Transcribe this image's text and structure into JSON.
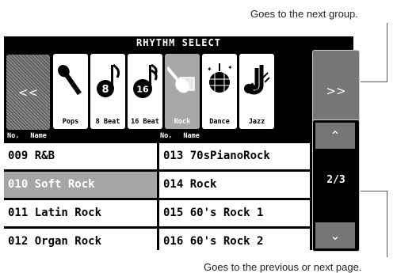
{
  "annotations": {
    "top": "Goes to the next group.",
    "bottom": "Goes to the previous or next page."
  },
  "screen": {
    "title": "RHYTHM SELECT",
    "prev_group_label": "<<",
    "next_group_label": ">>",
    "categories": [
      {
        "label": "Pops",
        "icon": "microphone-icon"
      },
      {
        "label": "8 Beat",
        "icon": "eighth-note-icon"
      },
      {
        "label": "16 Beat",
        "icon": "sixteenth-note-icon"
      },
      {
        "label": "Rock",
        "icon": "electric-guitar-icon",
        "selected": true
      },
      {
        "label": "Dance",
        "icon": "disco-ball-icon"
      },
      {
        "label": "Jazz",
        "icon": "saxophone-icon"
      }
    ],
    "column_headers": {
      "no": "No.",
      "name": "Name"
    },
    "rhythms": [
      {
        "text": "009 R&B"
      },
      {
        "text": "010 Soft Rock",
        "selected": true
      },
      {
        "text": "011 Latin Rock"
      },
      {
        "text": "012 Organ Rock"
      },
      {
        "text": "013 70sPianoRock"
      },
      {
        "text": "014 Rock"
      },
      {
        "text": "015 60's Rock 1"
      },
      {
        "text": "016 60's Rock 2"
      }
    ],
    "pager": {
      "up_label": "⌃",
      "down_label": "⌄",
      "page": "2/3"
    }
  }
}
